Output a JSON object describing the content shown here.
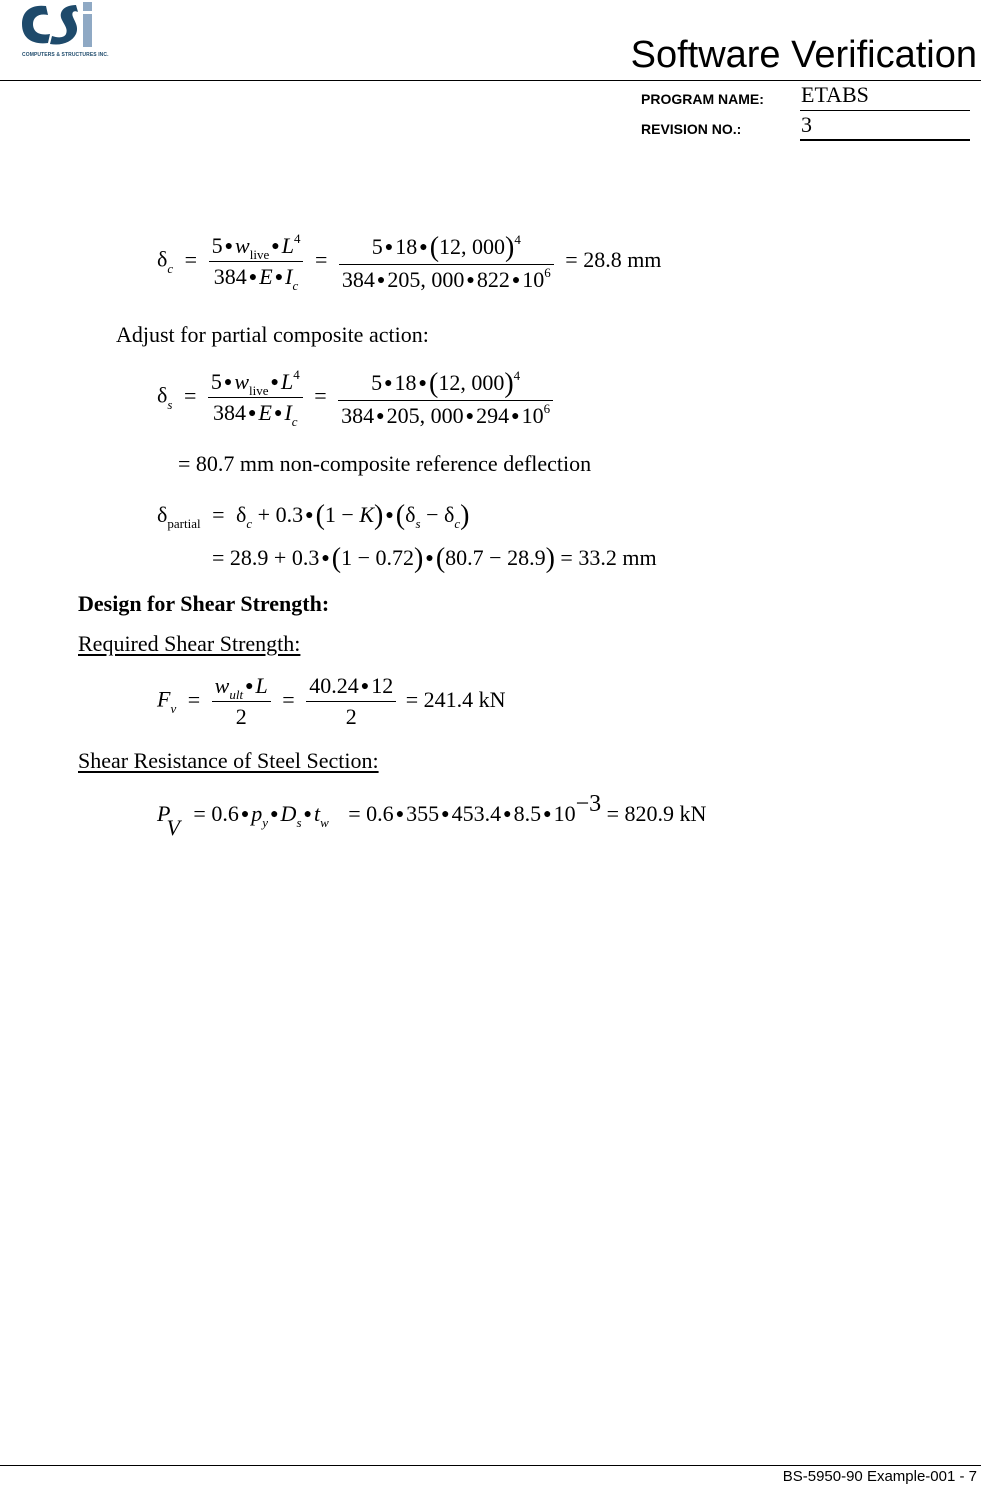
{
  "header": {
    "logo_alt": "CSI",
    "logo_subtitle": "COMPUTERS & STRUCTURES INC.",
    "title": "Software Verification",
    "program_name_label": "PROGRAM NAME:",
    "program_name_value": "ETABS",
    "revision_label": "REVISION NO.:",
    "revision_value": "3",
    "colors": {
      "logo_dark": "#1e4a6b",
      "logo_light": "#8fa9c4"
    }
  },
  "eq_delta_c": {
    "lhs": "δ",
    "lhs_sub": "c",
    "num1": [
      "5",
      "w",
      "live",
      "L",
      "4"
    ],
    "den1": [
      "384",
      "E",
      "I",
      "c"
    ],
    "num2": [
      "5",
      "18",
      "12, 000",
      "4"
    ],
    "den2": [
      "384",
      "205, 000",
      "822",
      "10",
      "6"
    ],
    "result": "= 28.8 mm"
  },
  "text_adjust": "Adjust for partial composite action:",
  "eq_delta_s": {
    "lhs": "δ",
    "lhs_sub": "s",
    "num1": [
      "5",
      "w",
      "live",
      "L",
      "4"
    ],
    "den1": [
      "384",
      "E",
      "I",
      "c"
    ],
    "num2": [
      "5",
      "18",
      "12, 000",
      "4"
    ],
    "den2": [
      "384",
      "205, 000",
      "294",
      "10",
      "6"
    ],
    "result_line": "= 80.7 mm non-composite reference deflection"
  },
  "eq_delta_partial": {
    "lhs": "δ",
    "lhs_sub": "partial",
    "line1": {
      "d": "δ",
      "c": "c",
      "coef": "+ 0.3",
      "one": "1 −",
      "K": "K",
      "s": "s",
      "minus": "−"
    },
    "line2": {
      "a": "= 28.9 + 0.3",
      "b": "1 − 0.72",
      "c": "80.7 − 28.9",
      "result": "= 33.2 mm"
    }
  },
  "heading_shear": "Design for Shear Strength:",
  "subheading_required": "Required Shear Strength:",
  "eq_fv": {
    "lhs": "F",
    "lhs_sub": "v",
    "num1": [
      "w",
      "ult",
      "L"
    ],
    "den1": "2",
    "num2": [
      "40.24",
      "12"
    ],
    "den2": "2",
    "result": "= 241.4 kN"
  },
  "subheading_resistance": "Shear Resistance of Steel Section:",
  "eq_pv": {
    "lhs": "P",
    "lhs_sub": "V",
    "terms": [
      "= 0.6",
      "p",
      "y",
      "D",
      "s",
      "t",
      "w"
    ],
    "calc": [
      "= 0.6",
      "355",
      "453.4",
      "8.5",
      "10",
      "−3"
    ],
    "result": "= 820.9 kN"
  },
  "footer": {
    "text": "BS-5950-90 Example-001 - 7"
  }
}
